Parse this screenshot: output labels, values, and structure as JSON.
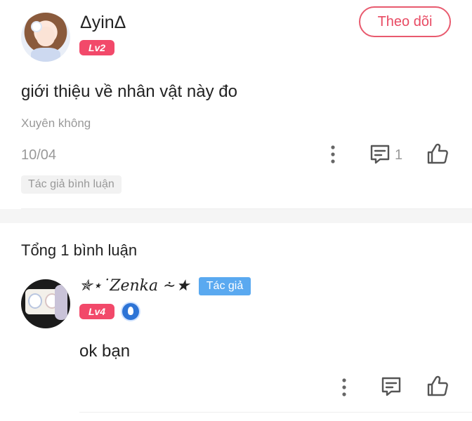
{
  "post": {
    "username": "ΔyinΔ",
    "level": "Lv2",
    "follow_label": "Theo dõi",
    "text": "giới thiệu về nhân vật này đo",
    "category": "Xuyên không",
    "date": "10/04",
    "comment_count": "1",
    "author_tag": "Tác giả bình luận"
  },
  "comments": {
    "total_label": "Tổng 1 bình luận",
    "items": [
      {
        "username": "✯⋆˙Zenka ⩪★",
        "author_badge": "Tác giả",
        "level": "Lv4",
        "text": "ok bạn"
      }
    ]
  },
  "colors": {
    "accent": "#e84a63",
    "level_badge": "#f2496a",
    "author_badge": "#5aa9f0",
    "muted_text": "#999999"
  },
  "icons": {
    "more": "more-vertical-icon",
    "comment": "comment-icon",
    "like": "thumbs-up-icon",
    "medal": "medal-icon"
  }
}
